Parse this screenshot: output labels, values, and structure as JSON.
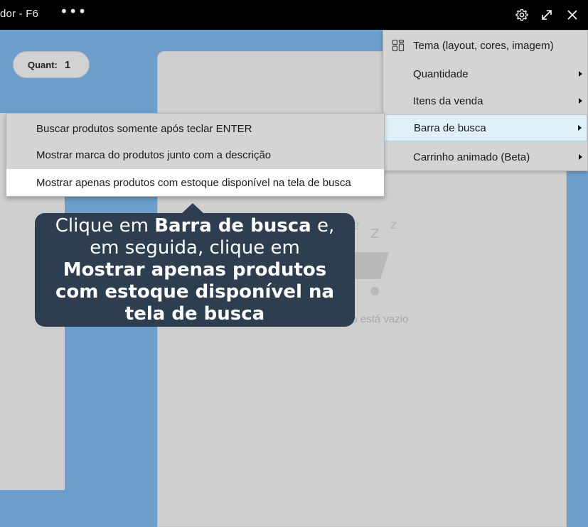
{
  "window": {
    "title": "dor - F6",
    "more_label": "•••"
  },
  "toolbar": {
    "icons": [
      "gear-icon",
      "expand-icon",
      "close-icon"
    ]
  },
  "quantity": {
    "label": "Quant:",
    "value": "1"
  },
  "cart": {
    "empty_text": "no está vazio",
    "zz_text": "z z z"
  },
  "settings_menu": {
    "items": [
      {
        "label": "Tema (layout, cores, imagem)",
        "icon": "layout-grid-icon",
        "has_submenu": false
      },
      {
        "label": "Quantidade",
        "has_submenu": true
      },
      {
        "label": "Itens da venda",
        "has_submenu": true
      },
      {
        "label": "Barra de busca",
        "has_submenu": true,
        "active": true
      },
      {
        "label": "Carrinho animado (Beta)",
        "has_submenu": true
      }
    ]
  },
  "search_bar_submenu": {
    "items": [
      {
        "label": "Buscar produtos somente após teclar ENTER"
      },
      {
        "label": "Mostrar marca do produtos junto com a descrição"
      },
      {
        "label": "Mostrar apenas produtos com estoque disponível na tela de busca",
        "highlighted": true
      }
    ]
  },
  "callout": {
    "part1": "Clique em ",
    "bold1": "Barra de busca",
    "part2": " e, em seguida, clique em ",
    "bold2": "Mostrar apenas produtos com estoque disponível na tela de busca"
  },
  "colors": {
    "background": "#6b9ecb",
    "panel": "#cfcfcf",
    "menu": "#d4d4d4",
    "active_item": "#dff0fb",
    "callout": "#2d3e50"
  }
}
